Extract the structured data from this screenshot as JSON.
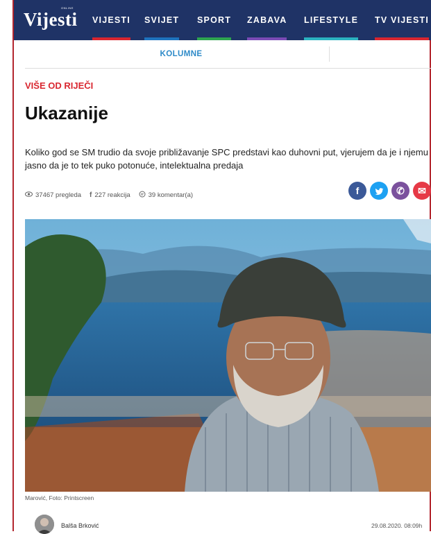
{
  "header": {
    "logo": "Vijesti",
    "logo_tag": "ONLINE",
    "nav": [
      {
        "label": "VIJESTI",
        "accent": "#d9262f"
      },
      {
        "label": "SVIJET",
        "accent": "#1e73be"
      },
      {
        "label": "SPORT",
        "accent": "#2ea44f"
      },
      {
        "label": "ZABAVA",
        "accent": "#7b4bb5"
      },
      {
        "label": "LIFESTYLE",
        "accent": "#2bb3c0"
      },
      {
        "label": "TV VIJESTI",
        "accent": "#d9262f"
      }
    ]
  },
  "subnav": {
    "item": "KOLUMNE"
  },
  "article": {
    "category": "VIŠE OD RIJEČI",
    "title": "Ukazanije",
    "lead": "Koliko god se SM trudio da svoje približavanje SPC predstavi kao duhovni put, vjerujem da je i njemu jasno da je to tek puko potonuće, intelektualna predaja",
    "views": "37467 pregleda",
    "reactions": "227 reakcija",
    "comments": "39 komentar(a)",
    "photo_caption": "Marović, Foto: Printscreen",
    "author": "Balša Brković",
    "date": "29.08.2020. 08:09h"
  },
  "social": [
    {
      "icon": "facebook-icon",
      "glyph": "f",
      "color": "#3b5998"
    },
    {
      "icon": "twitter-icon",
      "glyph": "t",
      "color": "#1da1f2"
    },
    {
      "icon": "viber-icon",
      "glyph": "✆",
      "color": "#7b519d"
    },
    {
      "icon": "email-icon",
      "glyph": "✉",
      "color": "#e63946"
    }
  ],
  "colors": {
    "header_bg": "#1f3366",
    "frame": "#b3262e",
    "category": "#d9262f",
    "link": "#2d8ac8"
  }
}
